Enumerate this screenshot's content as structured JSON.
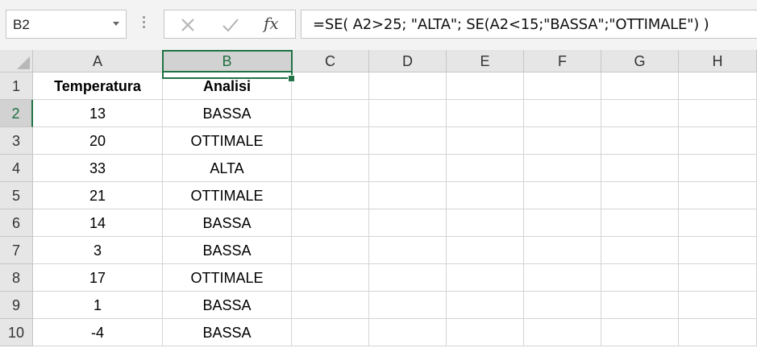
{
  "name_box": {
    "value": "B2"
  },
  "formula_bar": {
    "cancel_icon": "close-icon",
    "enter_icon": "check-icon",
    "function_label": "fx",
    "formula": "=SE( A2>25; \"ALTA\"; SE(A2<15;\"BASSA\";\"OTTIMALE\") )"
  },
  "columns": [
    "A",
    "B",
    "C",
    "D",
    "E",
    "F",
    "G",
    "H"
  ],
  "rows": [
    "1",
    "2",
    "3",
    "4",
    "5",
    "6",
    "7",
    "8",
    "9",
    "10"
  ],
  "selection": {
    "cell": "B2",
    "column": "B",
    "row": "2"
  },
  "sheet": {
    "headers": [
      "Temperatura",
      "Analisi"
    ],
    "data": [
      [
        "13",
        "BASSA"
      ],
      [
        "20",
        "OTTIMALE"
      ],
      [
        "33",
        "ALTA"
      ],
      [
        "21",
        "OTTIMALE"
      ],
      [
        "14",
        "BASSA"
      ],
      [
        "3",
        "BASSA"
      ],
      [
        "17",
        "OTTIMALE"
      ],
      [
        "1",
        "BASSA"
      ],
      [
        "-4",
        "BASSA"
      ]
    ]
  },
  "colors": {
    "accent": "#217346",
    "header_bg": "#e6e6e6",
    "selected_header_bg": "#d2d2d2"
  }
}
